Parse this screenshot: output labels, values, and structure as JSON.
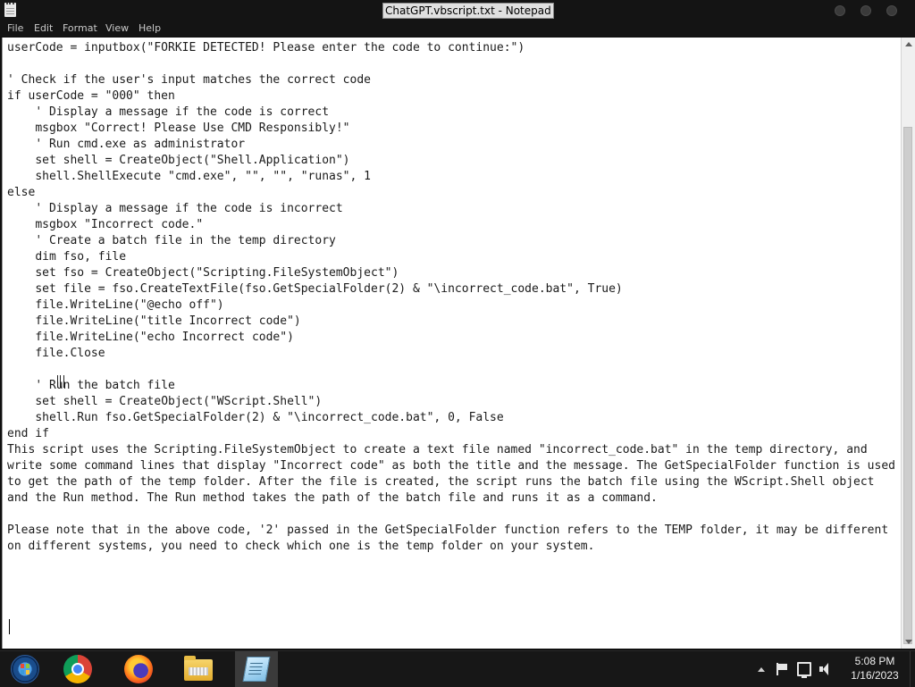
{
  "window": {
    "title": "ChatGPT.vbscript.txt - Notepad"
  },
  "menu": {
    "items": [
      "File",
      "Edit",
      "Format",
      "View",
      "Help"
    ]
  },
  "editor": {
    "content": "userCode = inputbox(\"FORKIE DETECTED! Please enter the code to continue:\")\n\n' Check if the user's input matches the correct code\nif userCode = \"000\" then\n    ' Display a message if the code is correct\n    msgbox \"Correct! Please Use CMD Responsibly!\"\n    ' Run cmd.exe as administrator\n    set shell = CreateObject(\"Shell.Application\")\n    shell.ShellExecute \"cmd.exe\", \"\", \"\", \"runas\", 1\nelse\n    ' Display a message if the code is incorrect\n    msgbox \"Incorrect code.\"\n    ' Create a batch file in the temp directory\n    dim fso, file\n    set fso = CreateObject(\"Scripting.FileSystemObject\")\n    set file = fso.CreateTextFile(fso.GetSpecialFolder(2) & \"\\incorrect_code.bat\", True)\n    file.WriteLine(\"@echo off\")\n    file.WriteLine(\"title Incorrect code\")\n    file.WriteLine(\"echo Incorrect code\")\n    file.Close\n\n    ' Run the batch file\n    set shell = CreateObject(\"WScript.Shell\")\n    shell.Run fso.GetSpecialFolder(2) & \"\\incorrect_code.bat\", 0, False\nend if\nThis script uses the Scripting.FileSystemObject to create a text file named \"incorrect_code.bat\" in the temp directory, and write some command lines that display \"Incorrect code\" as both the title and the message. The GetSpecialFolder function is used to get the path of the temp folder. After the file is created, the script runs the batch file using the WScript.Shell object and the Run method. The Run method takes the path of the batch file and runs it as a command.\n\nPlease note that in the above code, '2' passed in the GetSpecialFolder function refers to the TEMP folder, it may be different on different systems, you need to check which one is the temp folder on your system."
  },
  "taskbar": {
    "apps": [
      {
        "icon": "windows-start-icon"
      },
      {
        "icon": "chrome-icon"
      },
      {
        "icon": "firefox-icon"
      },
      {
        "icon": "file-explorer-icon"
      },
      {
        "icon": "notepad-icon",
        "active": true
      }
    ],
    "tray_icons": [
      "show-hidden-icons-chevron",
      "action-center-flag-icon",
      "network-icon",
      "volume-icon"
    ],
    "clock_time": "5:08 PM",
    "clock_date": "1/16/2023"
  }
}
